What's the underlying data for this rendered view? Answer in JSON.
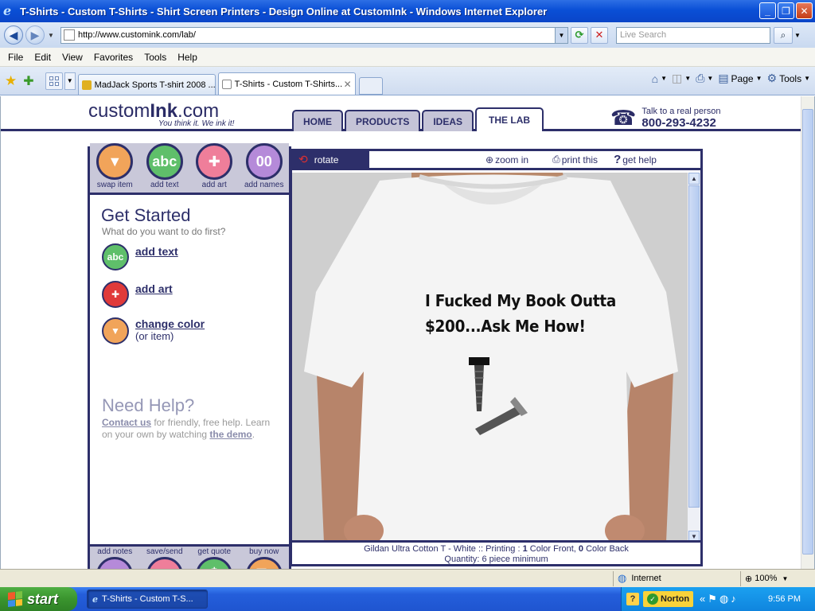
{
  "window": {
    "title": "T-Shirts - Custom T-Shirts - Shirt Screen Printers - Design Online at CustomInk - Windows Internet Explorer",
    "minimize": "_",
    "maximize": "❐",
    "close": "✕"
  },
  "addressbar": {
    "url": "http://www.customink.com/lab/",
    "search_placeholder": "Live Search"
  },
  "menu": [
    "File",
    "Edit",
    "View",
    "Favorites",
    "Tools",
    "Help"
  ],
  "tabs": [
    {
      "label": "MadJack Sports T-shirt 2008 ...",
      "active": false
    },
    {
      "label": "T-Shirts - Custom T-Shirts...",
      "active": true
    }
  ],
  "commandbar": {
    "page": "Page",
    "tools": "Tools"
  },
  "site": {
    "logo_pre": "custom",
    "logo_bold": "Ink",
    "logo_post": ".com",
    "tagline": "You think it. We ink it!",
    "nav": [
      {
        "label": "HOME",
        "active": false
      },
      {
        "label": "PRODUCTS",
        "active": false
      },
      {
        "label": "IDEAS",
        "active": false
      },
      {
        "label": "THE LAB",
        "active": true
      }
    ],
    "phone_label": "Talk to a real person",
    "phone_number": "800-293-4232"
  },
  "top_tools": [
    {
      "label": "swap item",
      "icon": "shirt-icon",
      "glyph": "👕",
      "color": "#f1a45a"
    },
    {
      "label": "add text",
      "icon": "text-icon",
      "glyph": "abc",
      "color": "#5fbf6a"
    },
    {
      "label": "add art",
      "icon": "art-icon",
      "glyph": "✚",
      "color": "#ef7e9a"
    },
    {
      "label": "add names",
      "icon": "names-icon",
      "glyph": "00",
      "color": "#b58ad9"
    }
  ],
  "bottom_tools": [
    {
      "label": "add notes",
      "icon": "notes-icon",
      "glyph": "✎",
      "color": "#b58ad9"
    },
    {
      "label": "save/send",
      "icon": "save-icon",
      "glyph": "💾",
      "color": "#ef7e9a"
    },
    {
      "label": "get quote",
      "icon": "dollar-icon",
      "glyph": "$",
      "color": "#5fbf6a"
    },
    {
      "label": "buy now",
      "icon": "cart-icon",
      "glyph": "🛒",
      "color": "#f1a45a"
    }
  ],
  "get_started": {
    "title": "Get Started",
    "subtitle": "What do you want to do first?",
    "add_text": "add text",
    "add_art": "add art",
    "change_color": "change color",
    "change_color_sub": "(or item)"
  },
  "need_help": {
    "title": "Need Help?",
    "contact": "Contact us",
    "contact_rest": " for friendly, free help.",
    "learn": "Learn on your own by watching ",
    "demo": "the demo",
    "end": "."
  },
  "canvas": {
    "rotate": "rotate",
    "zoom_in": "zoom in",
    "print_this": "print this",
    "get_help": "get help",
    "design_line1": "I Fucked My Book Outta",
    "design_line2": "$200...Ask Me How!",
    "product_prefix": "Gildan Ultra Cotton T - White :: Printing : ",
    "front_count": "1",
    "front_label": " Color Front, ",
    "back_count": "0",
    "back_label": " Color Back",
    "quantity": "Quantity: 6 piece minimum"
  },
  "status": {
    "zone": "Internet",
    "zoom": "100%"
  },
  "taskbar": {
    "start": "start",
    "task": "T-Shirts - Custom T-S...",
    "norton": "Norton",
    "clock": "9:56 PM"
  }
}
